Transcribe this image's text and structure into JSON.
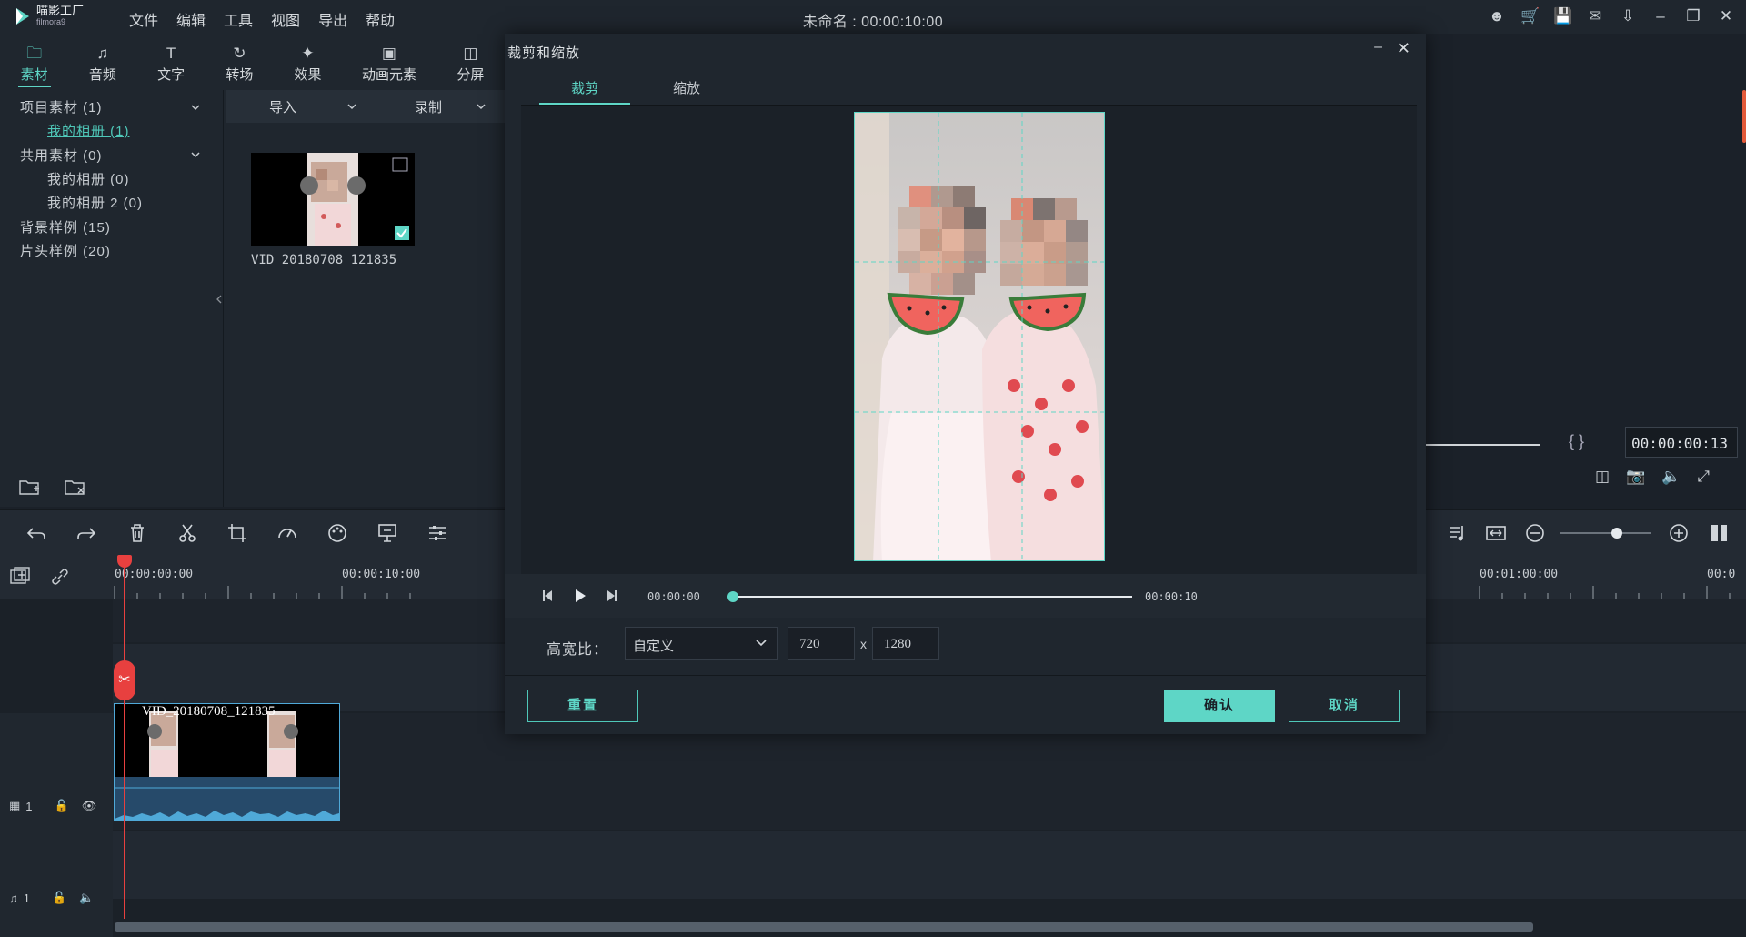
{
  "app": {
    "logo_name": "喵影工厂",
    "logo_sub": "filmora9",
    "title": "未命名 : 00:00:10:00",
    "menu": [
      "文件",
      "编辑",
      "工具",
      "视图",
      "导出",
      "帮助"
    ]
  },
  "left_tabs": [
    {
      "label": "素材",
      "icon": "folder-icon"
    },
    {
      "label": "音频",
      "icon": "music-note-icon"
    },
    {
      "label": "文字",
      "icon": "text-icon"
    },
    {
      "label": "转场",
      "icon": "transition-icon"
    },
    {
      "label": "效果",
      "icon": "effects-icon"
    },
    {
      "label": "动画元素",
      "icon": "image-icon"
    },
    {
      "label": "分屏",
      "icon": "split-screen-icon"
    }
  ],
  "tree": {
    "project": "项目素材 (1)",
    "project_album": "我的相册 (1)",
    "shared": "共用素材 (0)",
    "shared_album": "我的相册 (0)",
    "shared_album2": "我的相册 2 (0)",
    "bg_samples": "背景样例 (15)",
    "intro_samples": "片头样例 (20)"
  },
  "media": {
    "import_label": "导入",
    "record_label": "录制",
    "clip_name": "VID_20180708_121835"
  },
  "preview": {
    "timecode": "00:00:00:13"
  },
  "timeline": {
    "ruler": [
      "00:00:00:00",
      "00:00:10:00",
      "00:01:00:00",
      "00:0"
    ],
    "clip_label": "VID_20180708_121835",
    "video_track": "1",
    "audio_track": "1"
  },
  "dialog": {
    "title": "裁剪和缩放",
    "tabs": [
      "裁剪",
      "缩放"
    ],
    "time_start": "00:00:00",
    "time_end": "00:00:10",
    "progress": 0.0,
    "aspect_label": "高宽比：",
    "aspect_value": "自定义",
    "width": "720",
    "x": "x",
    "height": "1280",
    "reset": "重置",
    "confirm": "确认",
    "cancel": "取消"
  },
  "colors": {
    "accent": "#5ed6c6",
    "playhead": "#e8403f",
    "clip_border": "#4fa9d8"
  }
}
